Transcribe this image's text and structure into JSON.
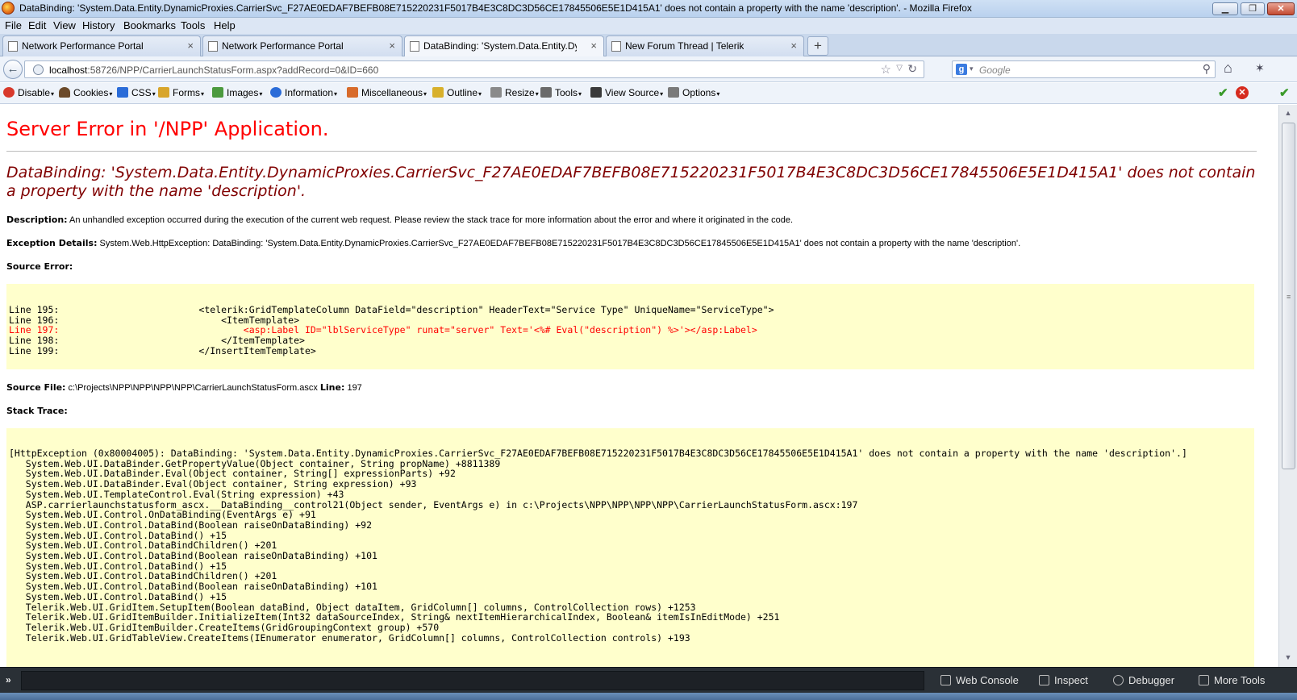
{
  "window": {
    "title": "DataBinding: 'System.Data.Entity.DynamicProxies.CarrierSvc_F27AE0EDAF7BEFB08E715220231F5017B4E3C8DC3D56CE17845506E5E1D415A1' does not contain a property with the name 'description'. - Mozilla Firefox",
    "min_glyph": "▁",
    "max_glyph": "❐",
    "close_glyph": "✕"
  },
  "menubar": {
    "items": [
      "File",
      "Edit",
      "View",
      "History",
      "Bookmarks",
      "Tools",
      "Help"
    ]
  },
  "tabs": [
    {
      "label": "Network Performance Portal",
      "close": "×"
    },
    {
      "label": "Network Performance Portal",
      "close": "×"
    },
    {
      "label": "DataBinding: 'System.Data.Entity.Dyn...",
      "close": "×"
    },
    {
      "label": "New Forum Thread | Telerik",
      "close": "×"
    }
  ],
  "newtab_glyph": "+",
  "nav": {
    "back_glyph": "←",
    "url_host": "localhost",
    "url_rest": ":58726/NPP/CarrierLaunchStatusForm.aspx?addRecord=0&ID=660",
    "star_glyph": "☆",
    "drop_glyph": "▽",
    "reload_glyph": "↻",
    "search_engine_glyph": "g",
    "search_drop_glyph": "▾",
    "search_placeholder": "Google",
    "search_glyph": "⚲",
    "home_glyph": "⌂",
    "addon_glyph": "✶"
  },
  "devbar": {
    "items": [
      {
        "label": "Disable",
        "color": "#d8392b"
      },
      {
        "label": "Cookies",
        "color": "#6b4a2a"
      },
      {
        "label": "CSS",
        "color": "#2b6cd8"
      },
      {
        "label": "Forms",
        "color": "#d8a52b"
      },
      {
        "label": "Images",
        "color": "#4c9a3e"
      },
      {
        "label": "Information",
        "color": "#2b6cd8"
      },
      {
        "label": "Miscellaneous",
        "color": "#d86b2b"
      },
      {
        "label": "Outline",
        "color": "#d8b02b"
      },
      {
        "label": "Resize",
        "color": "#8a8a8a"
      },
      {
        "label": "Tools",
        "color": "#6a6a6a"
      },
      {
        "label": "View Source",
        "color": "#3a3a3a"
      },
      {
        "label": "Options",
        "color": "#7a7a7a"
      }
    ],
    "caret": "▾",
    "ok_glyph": "✔",
    "err_glyph": "✕"
  },
  "page": {
    "h1": "Server Error in '/NPP' Application.",
    "h2": "DataBinding: 'System.Data.Entity.DynamicProxies.CarrierSvc_F27AE0EDAF7BEFB08E715220231F5017B4E3C8DC3D56CE17845506E5E1D415A1' does not contain a property with the name 'description'.",
    "description_label": "Description:",
    "description_text": " An unhandled exception occurred during the execution of the current web request. Please review the stack trace for more information about the error and where it originated in the code.",
    "exception_label": "Exception Details:",
    "exception_text": " System.Web.HttpException: DataBinding: 'System.Data.Entity.DynamicProxies.CarrierSvc_F27AE0EDAF7BEFB08E715220231F5017B4E3C8DC3D56CE17845506E5E1D415A1' does not contain a property with the name 'description'.",
    "source_error_label": "Source Error:",
    "source_lines": [
      "Line 195:                         <telerik:GridTemplateColumn DataField=\"description\" HeaderText=\"Service Type\" UniqueName=\"ServiceType\">",
      "Line 196:                             <ItemTemplate>",
      "Line 197:                                 <asp:Label ID=\"lblServiceType\" runat=\"server\" Text='<%# Eval(\"description\") %>'></asp:Label>",
      "Line 198:                             </ItemTemplate>",
      "Line 199:                         </InsertItemTemplate>"
    ],
    "source_file_label": "Source File:",
    "source_file_value": " c:\\Projects\\NPP\\NPP\\NPP\\NPP\\CarrierLaunchStatusForm.ascx    ",
    "line_label": "Line:",
    "line_value": " 197",
    "stack_trace_label": "Stack Trace:",
    "stack_lines": [
      "[HttpException (0x80004005): DataBinding: 'System.Data.Entity.DynamicProxies.CarrierSvc_F27AE0EDAF7BEFB08E715220231F5017B4E3C8DC3D56CE17845506E5E1D415A1' does not contain a property with the name 'description'.]",
      "   System.Web.UI.DataBinder.GetPropertyValue(Object container, String propName) +8811389",
      "   System.Web.UI.DataBinder.Eval(Object container, String[] expressionParts) +92",
      "   System.Web.UI.DataBinder.Eval(Object container, String expression) +93",
      "   System.Web.UI.TemplateControl.Eval(String expression) +43",
      "   ASP.carrierlaunchstatusform_ascx.__DataBinding__control21(Object sender, EventArgs e) in c:\\Projects\\NPP\\NPP\\NPP\\NPP\\CarrierLaunchStatusForm.ascx:197",
      "   System.Web.UI.Control.OnDataBinding(EventArgs e) +91",
      "   System.Web.UI.Control.DataBind(Boolean raiseOnDataBinding) +92",
      "   System.Web.UI.Control.DataBind() +15",
      "   System.Web.UI.Control.DataBindChildren() +201",
      "   System.Web.UI.Control.DataBind(Boolean raiseOnDataBinding) +101",
      "   System.Web.UI.Control.DataBind() +15",
      "   System.Web.UI.Control.DataBindChildren() +201",
      "   System.Web.UI.Control.DataBind(Boolean raiseOnDataBinding) +101",
      "   System.Web.UI.Control.DataBind() +15",
      "   Telerik.Web.UI.GridItem.SetupItem(Boolean dataBind, Object dataItem, GridColumn[] columns, ControlCollection rows) +1253",
      "   Telerik.Web.UI.GridItemBuilder.InitializeItem(Int32 dataSourceIndex, String& nextItemHierarchicalIndex, Boolean& itemIsInEditMode) +251",
      "   Telerik.Web.UI.GridItemBuilder.CreateItems(GridGroupingContext group) +570",
      "   Telerik.Web.UI.GridTableView.CreateItems(IEnumerator enumerator, GridColumn[] columns, ControlCollection controls) +193"
    ]
  },
  "scrollbar": {
    "up_glyph": "▲",
    "down_glyph": "▼",
    "grip_glyph": "≡"
  },
  "devtools": {
    "prompt": "»",
    "buttons": [
      "Web Console",
      "Inspect",
      "Debugger",
      "More Tools"
    ]
  }
}
